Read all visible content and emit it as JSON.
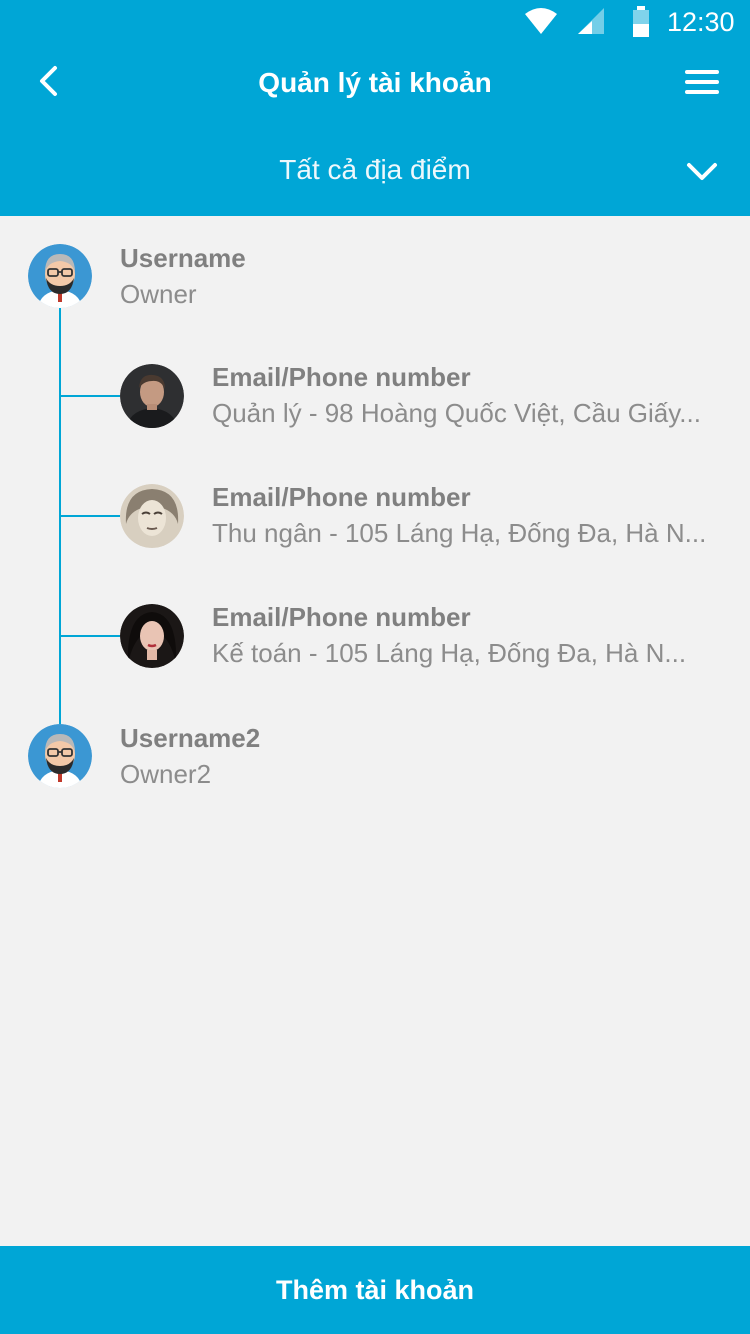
{
  "status_bar": {
    "time": "12:30",
    "icons": [
      "wifi-icon",
      "signal-icon",
      "battery-icon"
    ]
  },
  "header": {
    "title": "Quản lý tài khoản",
    "back_icon": "chevron-left-icon",
    "menu_icon": "hamburger-menu-icon",
    "location_filter": "Tất cả địa điểm",
    "location_icon": "chevron-down-icon"
  },
  "accounts": [
    {
      "primary": "Username",
      "secondary": "Owner",
      "avatar": "bearded-man-avatar",
      "children": [
        {
          "primary": "Email/Phone number",
          "secondary": "Quản lý - 98 Hoàng Quốc Việt, Cầu Giấy...",
          "avatar": "man-photo-avatar"
        },
        {
          "primary": "Email/Phone number",
          "secondary": "Thu ngân - 105 Láng Hạ, Đống Đa, Hà N...",
          "avatar": "woman-sketch-avatar"
        },
        {
          "primary": "Email/Phone number",
          "secondary": "Kế toán - 105 Láng Hạ, Đống Đa, Hà N...",
          "avatar": "woman-photo-avatar"
        }
      ]
    },
    {
      "primary": "Username2",
      "secondary": "Owner2",
      "avatar": "bearded-man-avatar",
      "children": []
    }
  ],
  "footer": {
    "add_button": "Thêm tài khoản"
  },
  "colors": {
    "accent": "#00a6d6",
    "background": "#f2f2f2",
    "text_gray": "#808080"
  }
}
